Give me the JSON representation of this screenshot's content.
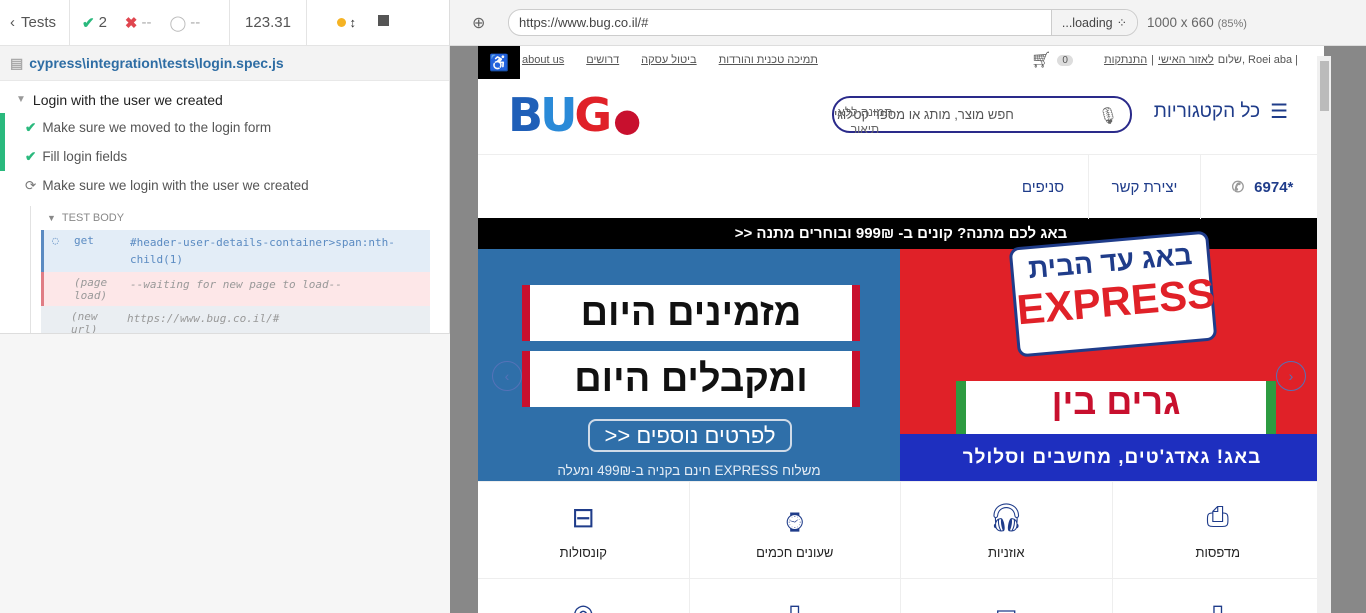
{
  "reporter": {
    "tests_label": "Tests",
    "passed": "2",
    "failed": "--",
    "pending": "--",
    "duration": "123.31",
    "spec_path": "cypress\\integration\\tests\\login.spec.js",
    "suite_title": "Login with the user we created",
    "tests": [
      {
        "title": "Make sure we moved to the login form",
        "state": "passed"
      },
      {
        "title": "Fill login fields",
        "state": "passed"
      },
      {
        "title": "Make sure we login with the user we created",
        "state": "running"
      }
    ],
    "test_body_label": "TEST BODY",
    "commands": [
      {
        "name": "get",
        "message": "#header-user-details-container>span:nth-child(1)"
      },
      {
        "name": "(page load)",
        "message": "--waiting for new page to load--"
      },
      {
        "name": "(new url)",
        "message": "https://www.bug.co.il/#"
      }
    ]
  },
  "browser": {
    "url": "https://www.bug.co.il/#",
    "loading_label": "...loading",
    "viewport_size": "1000 x 660",
    "zoom": "(85%)"
  },
  "site": {
    "topnav_links": [
      "about us",
      "דרושים",
      "ביטול עסקה",
      "תמיכה טכנית והורדות"
    ],
    "cart_count": "0",
    "user_greeting": "שלום, Roei aba |",
    "personal_area": "לאזור האישי",
    "logout": "התנתקות",
    "logo_text": "BUG",
    "search_placeholder": "חפש מוצר, מותג או מספר קטלוגי",
    "no_image_alt": "תמונה ללא תיאור",
    "all_categories": "כל הקטגוריות",
    "phone": "6974*",
    "contact": "יצירת קשר",
    "branches": "סניפים",
    "promo": "באג לכם מתנה? קונים ב- 999₪ ובוחרים מתנה <<",
    "banner_left": {
      "line1": "מזמינים היום",
      "line2": "ומקבלים היום",
      "more": "לפרטים נוספים <<",
      "shipping": "משלוח EXPRESS חינם בקניה ב-499₪ ומעלה"
    },
    "banner_right": {
      "line1": "באג עד הבית",
      "line2": "EXPRESS",
      "line3": "גרים בין",
      "caption": "באג! גאדג'טים, מחשבים וסלולר"
    },
    "categories": [
      "קונסולות",
      "שעונים חכמים",
      "אוזניות",
      "מדפסות"
    ]
  }
}
